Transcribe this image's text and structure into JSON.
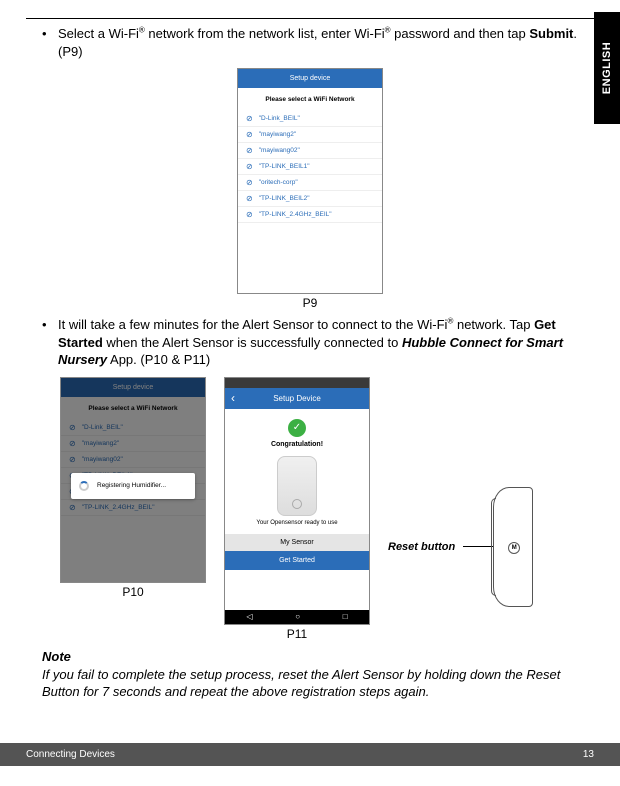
{
  "side_tab": "ENGLISH",
  "bullet1": {
    "pre": "Select a Wi-Fi",
    "sup1": "®",
    "mid": " network from the network list, enter Wi-Fi",
    "sup2": "®",
    "post": " password and then tap ",
    "bold": "Submit",
    "tail": ". (P9)"
  },
  "bullet2": {
    "pre": "It will take a few minutes for the Alert Sensor to connect to the Wi-Fi",
    "sup": "®",
    "mid": " network. Tap ",
    "bold1": "Get Started",
    "mid2": " when the Alert Sensor is successfully connected to ",
    "ibold": "Hubble Connect for Smart Nursery",
    "tail": " App. (P10 & P11)"
  },
  "p9": {
    "header": "Setup device",
    "sub": "Please select a WiFi Network",
    "wifis": [
      "\"D-Link_BEIL\"",
      "\"mayiwang2\"",
      "\"mayiwang02\"",
      "\"TP-LINK_BEIL1\"",
      "\"oritech-corp\"",
      "\"TP-LINK_BEIL2\"",
      "\"TP-LINK_2.4GHz_BEIL\""
    ],
    "caption": "P9"
  },
  "p10": {
    "header": "Setup device",
    "sub": "Please select a WiFi Network",
    "wifis": [
      "\"D-Link_BEIL\"",
      "\"mayiwang2\"",
      "\"mayiwang02\"",
      "\"TP-LINK_BEIL1\"",
      "\"oritech-corp\"",
      "\"TP-LINK_2.4GHz_BEIL\""
    ],
    "dialog": "Registering Humidifier...",
    "caption": "P10"
  },
  "p11": {
    "header": "Setup Device",
    "congrats": "Congratulation!",
    "ready": "Your Opensensor ready to use",
    "my_sensor": "My Sensor",
    "get_started": "Get Started",
    "caption": "P11"
  },
  "reset_label": "Reset button",
  "note": {
    "head": "Note",
    "body": "If you fail to complete the setup process, reset the Alert Sensor by holding down the Reset Button for 7 seconds and repeat the above registration steps again."
  },
  "footer": {
    "left": "Connecting Devices",
    "right": "13"
  }
}
